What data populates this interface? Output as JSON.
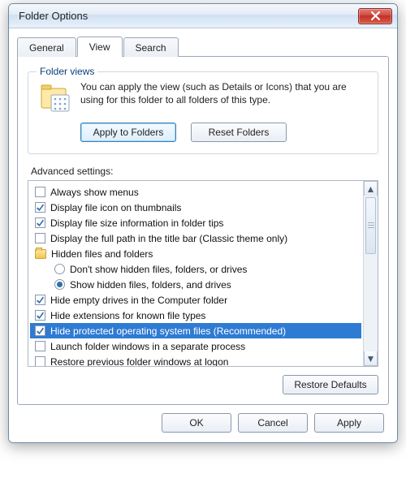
{
  "window": {
    "title": "Folder Options"
  },
  "tabs": [
    {
      "label": "General",
      "active": false
    },
    {
      "label": "View",
      "active": true
    },
    {
      "label": "Search",
      "active": false
    }
  ],
  "folder_views": {
    "legend": "Folder views",
    "text": "You can apply the view (such as Details or Icons) that you are using for this folder to all folders of this type.",
    "apply_btn": "Apply to Folders",
    "reset_btn": "Reset Folders"
  },
  "advanced": {
    "label": "Advanced settings:",
    "items": [
      {
        "kind": "check",
        "checked": false,
        "label": "Always show menus"
      },
      {
        "kind": "check",
        "checked": true,
        "label": "Display file icon on thumbnails"
      },
      {
        "kind": "check",
        "checked": true,
        "label": "Display file size information in folder tips"
      },
      {
        "kind": "check",
        "checked": false,
        "label": "Display the full path in the title bar (Classic theme only)"
      },
      {
        "kind": "group",
        "label": "Hidden files and folders"
      },
      {
        "kind": "radio",
        "checked": false,
        "label": "Don't show hidden files, folders, or drives"
      },
      {
        "kind": "radio",
        "checked": true,
        "label": "Show hidden files, folders, and drives"
      },
      {
        "kind": "check",
        "checked": true,
        "label": "Hide empty drives in the Computer folder"
      },
      {
        "kind": "check",
        "checked": true,
        "label": "Hide extensions for known file types"
      },
      {
        "kind": "check",
        "checked": true,
        "selected": true,
        "label": "Hide protected operating system files (Recommended)"
      },
      {
        "kind": "check",
        "checked": false,
        "label": "Launch folder windows in a separate process"
      },
      {
        "kind": "check",
        "checked": false,
        "label": "Restore previous folder windows at logon"
      }
    ],
    "restore_btn": "Restore Defaults"
  },
  "dialog_buttons": {
    "ok": "OK",
    "cancel": "Cancel",
    "apply": "Apply"
  }
}
